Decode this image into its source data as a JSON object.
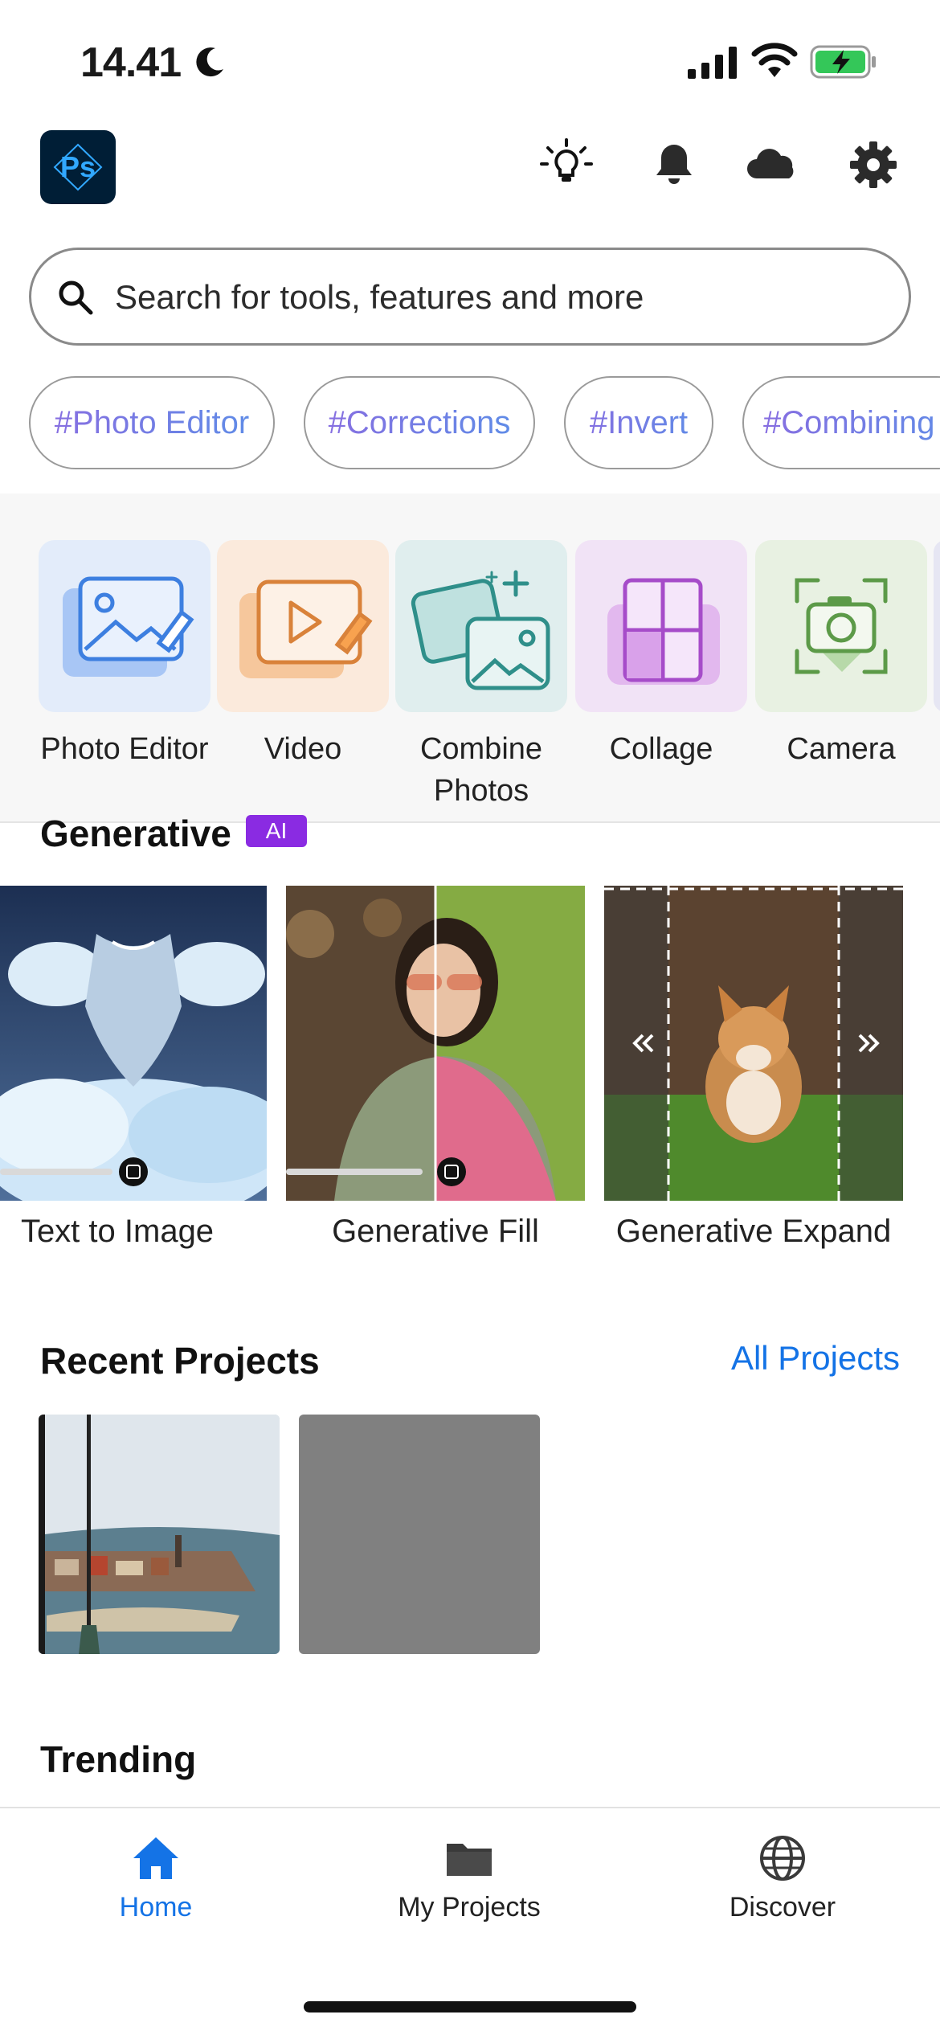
{
  "status_bar": {
    "time": "14.41"
  },
  "header": {
    "logo_text": "Ps"
  },
  "search": {
    "placeholder": "Search for tools, features and more"
  },
  "chips": [
    "#Photo Editor",
    "#Corrections",
    "#Invert",
    "#Combining"
  ],
  "tools": [
    {
      "label": "Photo Editor"
    },
    {
      "label": "Video"
    },
    {
      "label": "Combine Photos"
    },
    {
      "label": "Collage"
    },
    {
      "label": "Camera"
    }
  ],
  "generative": {
    "title": "Generative",
    "badge": "AI",
    "cards": [
      {
        "label": "Text to Image"
      },
      {
        "label": "Generative Fill"
      },
      {
        "label": "Generative Expand"
      }
    ]
  },
  "recent_projects": {
    "title": "Recent Projects",
    "link": "All Projects"
  },
  "trending": {
    "title": "Trending"
  },
  "bottom_nav": [
    {
      "label": "Home",
      "active": true
    },
    {
      "label": "My Projects",
      "active": false
    },
    {
      "label": "Discover",
      "active": false
    }
  ],
  "colors": {
    "accent": "#1473e6",
    "ai_badge": "#8a2be2",
    "logo_bg": "#001e36",
    "logo_fg": "#31a8ff"
  }
}
